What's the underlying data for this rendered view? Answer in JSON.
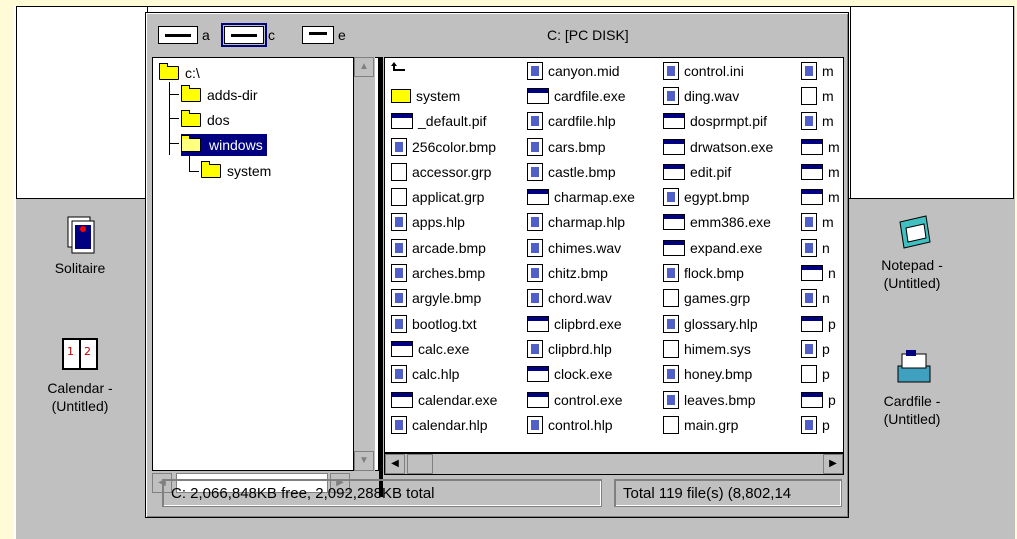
{
  "desktop": {
    "icons": [
      {
        "id": "solitaire",
        "label": "Solitaire"
      },
      {
        "id": "calendar",
        "label": "Calendar - (Untitled)"
      },
      {
        "id": "notepad",
        "label": "Notepad - (Untitled)"
      },
      {
        "id": "cardfile",
        "label": "Cardfile - (Untitled)"
      }
    ]
  },
  "window": {
    "title": "C: [PC DISK]",
    "drives": [
      {
        "letter": "a",
        "selected": false
      },
      {
        "letter": "c",
        "selected": true
      },
      {
        "letter": "e",
        "selected": false
      }
    ],
    "tree": [
      {
        "label": "c:\\",
        "level": 0
      },
      {
        "label": "adds-dir",
        "level": 1
      },
      {
        "label": "dos",
        "level": 1
      },
      {
        "label": "windows",
        "level": 1,
        "selected": true,
        "open": true
      },
      {
        "label": "system",
        "level": 2
      }
    ],
    "files": [
      [
        {
          "name": "",
          "icon": "up"
        },
        {
          "name": "system",
          "icon": "folder"
        },
        {
          "name": "_default.pif",
          "icon": "exe"
        },
        {
          "name": "256color.bmp",
          "icon": "doc"
        },
        {
          "name": "accessor.grp",
          "icon": "blank"
        },
        {
          "name": "applicat.grp",
          "icon": "blank"
        },
        {
          "name": "apps.hlp",
          "icon": "doc"
        },
        {
          "name": "arcade.bmp",
          "icon": "doc"
        },
        {
          "name": "arches.bmp",
          "icon": "doc"
        },
        {
          "name": "argyle.bmp",
          "icon": "doc"
        },
        {
          "name": "bootlog.txt",
          "icon": "doc"
        },
        {
          "name": "calc.exe",
          "icon": "exe"
        },
        {
          "name": "calc.hlp",
          "icon": "doc"
        },
        {
          "name": "calendar.exe",
          "icon": "exe"
        },
        {
          "name": "calendar.hlp",
          "icon": "doc"
        }
      ],
      [
        {
          "name": "canyon.mid",
          "icon": "doc"
        },
        {
          "name": "cardfile.exe",
          "icon": "exe"
        },
        {
          "name": "cardfile.hlp",
          "icon": "doc"
        },
        {
          "name": "cars.bmp",
          "icon": "doc"
        },
        {
          "name": "castle.bmp",
          "icon": "doc"
        },
        {
          "name": "charmap.exe",
          "icon": "exe"
        },
        {
          "name": "charmap.hlp",
          "icon": "doc"
        },
        {
          "name": "chimes.wav",
          "icon": "doc"
        },
        {
          "name": "chitz.bmp",
          "icon": "doc"
        },
        {
          "name": "chord.wav",
          "icon": "doc"
        },
        {
          "name": "clipbrd.exe",
          "icon": "exe"
        },
        {
          "name": "clipbrd.hlp",
          "icon": "doc"
        },
        {
          "name": "clock.exe",
          "icon": "exe"
        },
        {
          "name": "control.exe",
          "icon": "exe"
        },
        {
          "name": "control.hlp",
          "icon": "doc"
        }
      ],
      [
        {
          "name": "control.ini",
          "icon": "doc"
        },
        {
          "name": "ding.wav",
          "icon": "doc"
        },
        {
          "name": "dosprmpt.pif",
          "icon": "exe"
        },
        {
          "name": "drwatson.exe",
          "icon": "exe"
        },
        {
          "name": "edit.pif",
          "icon": "exe"
        },
        {
          "name": "egypt.bmp",
          "icon": "doc"
        },
        {
          "name": "emm386.exe",
          "icon": "exe"
        },
        {
          "name": "expand.exe",
          "icon": "exe"
        },
        {
          "name": "flock.bmp",
          "icon": "doc"
        },
        {
          "name": "games.grp",
          "icon": "blank"
        },
        {
          "name": "glossary.hlp",
          "icon": "doc"
        },
        {
          "name": "himem.sys",
          "icon": "blank"
        },
        {
          "name": "honey.bmp",
          "icon": "doc"
        },
        {
          "name": "leaves.bmp",
          "icon": "doc"
        },
        {
          "name": "main.grp",
          "icon": "blank"
        }
      ],
      [
        {
          "name": "m",
          "icon": "doc"
        },
        {
          "name": "m",
          "icon": "blank"
        },
        {
          "name": "m",
          "icon": "doc"
        },
        {
          "name": "m",
          "icon": "exe"
        },
        {
          "name": "m",
          "icon": "exe"
        },
        {
          "name": "m",
          "icon": "exe"
        },
        {
          "name": "m",
          "icon": "doc"
        },
        {
          "name": "n",
          "icon": "doc"
        },
        {
          "name": "n",
          "icon": "exe"
        },
        {
          "name": "n",
          "icon": "doc"
        },
        {
          "name": "p",
          "icon": "exe"
        },
        {
          "name": "p",
          "icon": "doc"
        },
        {
          "name": "p",
          "icon": "blank"
        },
        {
          "name": "p",
          "icon": "exe"
        },
        {
          "name": "p",
          "icon": "doc"
        }
      ]
    ],
    "status": {
      "left": "C: 2,066,848KB free,  2,092,288KB total",
      "right": "Total 119 file(s) (8,802,14"
    }
  }
}
